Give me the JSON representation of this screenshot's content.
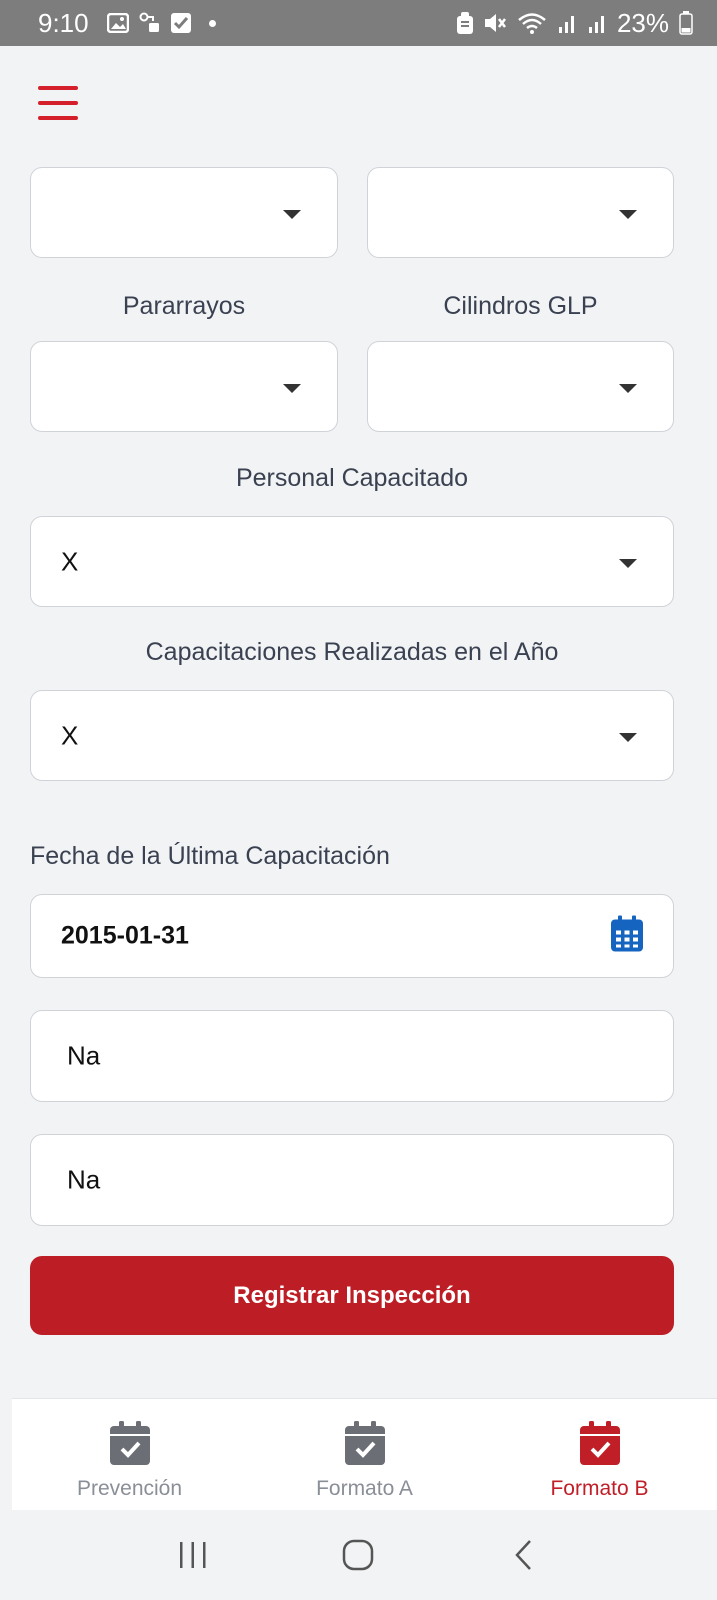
{
  "status_bar": {
    "time": "9:10",
    "battery": "23%",
    "icons": [
      "gallery-icon",
      "key-icon",
      "checkbox-icon",
      "dot-icon",
      "lock-icon",
      "mute-icon",
      "wifi-icon",
      "signal-icon",
      "signal-icon",
      "battery-icon"
    ]
  },
  "form": {
    "row1": {
      "left_value": "",
      "right_value": ""
    },
    "pararrayos": {
      "label": "Pararrayos",
      "value": ""
    },
    "cilindros": {
      "label": "Cilindros GLP",
      "value": ""
    },
    "personal": {
      "label": "Personal Capacitado",
      "value": "X"
    },
    "capacitaciones": {
      "label": "Capacitaciones Realizadas en el Año",
      "value": "X"
    },
    "fecha": {
      "label": "Fecha de la Última Capacitación",
      "value": "2015-01-31"
    },
    "text1": {
      "value": "Na"
    },
    "text2": {
      "value": "Na"
    },
    "submit_label": "Registrar Inspección"
  },
  "bottom_nav": {
    "items": [
      {
        "label": "Prevención",
        "active": false
      },
      {
        "label": "Formato A",
        "active": false
      },
      {
        "label": "Formato B",
        "active": true
      }
    ]
  },
  "colors": {
    "accent": "#bd1e25",
    "calendar_blue": "#1565c0",
    "inactive_icon": "#6b6f75"
  }
}
